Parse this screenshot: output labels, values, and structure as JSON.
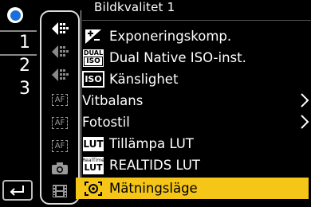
{
  "menu": {
    "title": "Bildkvalitet 1",
    "items": [
      {
        "label": "Exponeringskomp.",
        "icon": "exposure-compensation-icon",
        "submenu": false
      },
      {
        "label": "Dual Native ISO-inst.",
        "icon": "dual-iso-icon",
        "icon_text_top": "DUAL",
        "icon_text_bottom": "ISO",
        "submenu": false
      },
      {
        "label": "Känslighet",
        "icon": "iso-icon",
        "icon_text": "ISO",
        "submenu": false
      },
      {
        "label": "Vitbalans",
        "icon": "",
        "submenu": true
      },
      {
        "label": "Fotostil",
        "icon": "",
        "submenu": true
      },
      {
        "label": "Tillämpa LUT",
        "icon": "lut-icon",
        "icon_text": "LUT",
        "submenu": false
      },
      {
        "label": "REALTIDS LUT",
        "icon": "realtime-lut-icon",
        "icon_text_top": "RealTime",
        "icon_text_bottom": "LUT",
        "submenu": false
      },
      {
        "label": "Mätningsläge",
        "icon": "metering-mode-icon",
        "submenu": false,
        "selected": true
      }
    ]
  },
  "pages": [
    "1",
    "2",
    "3"
  ],
  "active_page": "1",
  "tabs": [
    {
      "name": "image-quality-tab",
      "active": true
    },
    {
      "name": "image-quality-tab-2",
      "active": false
    },
    {
      "name": "image-quality-tab-3",
      "active": false
    },
    {
      "name": "af-tab-1",
      "label": "AF"
    },
    {
      "name": "af-tab-2",
      "label": "AF"
    },
    {
      "name": "af-tab-3",
      "label": "AF"
    },
    {
      "name": "photo-camera-tab"
    },
    {
      "name": "video-tab"
    }
  ],
  "colors": {
    "accent": "#f5c518",
    "mode_blue": "#1a6fd8",
    "background": "#000000"
  }
}
